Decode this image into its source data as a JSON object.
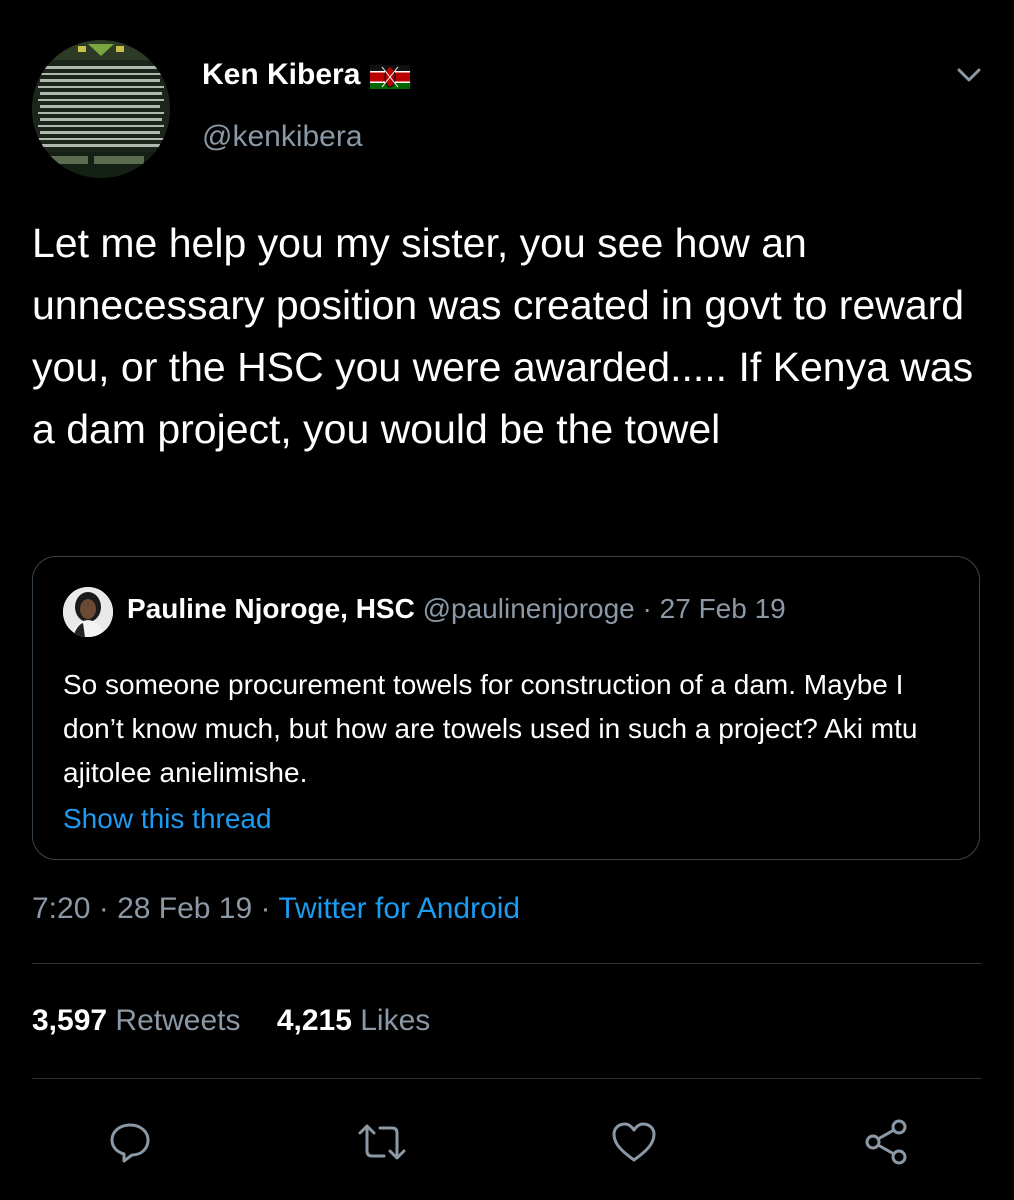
{
  "tweet": {
    "display_name": "Ken Kibera",
    "handle": "@kenkibera",
    "text": "Let me help you my sister, you see how an unnecessary position was created in govt to reward you, or the HSC you were awarded..... If Kenya was a dam project, you would be the towel",
    "time": "7:20",
    "date": "28 Feb 19",
    "separator": "·",
    "source": "Twitter for Android"
  },
  "quoted": {
    "display_name": "Pauline Njoroge, HSC",
    "handle": "@paulinenjoroge",
    "separator": "·",
    "date": "27 Feb 19",
    "text": "So someone procurement towels for construction of a dam. Maybe I don’t know much, but how are towels used in such a project? Aki mtu ajitolee anielimishe.",
    "thread_link": "Show this thread"
  },
  "stats": {
    "retweets_count": "3,597",
    "retweets_label": "Retweets",
    "likes_count": "4,215",
    "likes_label": "Likes"
  },
  "icons": {
    "flag": "kenya-flag-icon",
    "caret": "chevron-down-icon",
    "reply": "reply-icon",
    "retweet": "retweet-icon",
    "like": "heart-icon",
    "share": "share-icon"
  },
  "colors": {
    "background": "#000000",
    "primary_text": "#ffffff",
    "secondary_text": "#8b98a5",
    "link": "#1d9bf0",
    "border": "#38444d"
  }
}
